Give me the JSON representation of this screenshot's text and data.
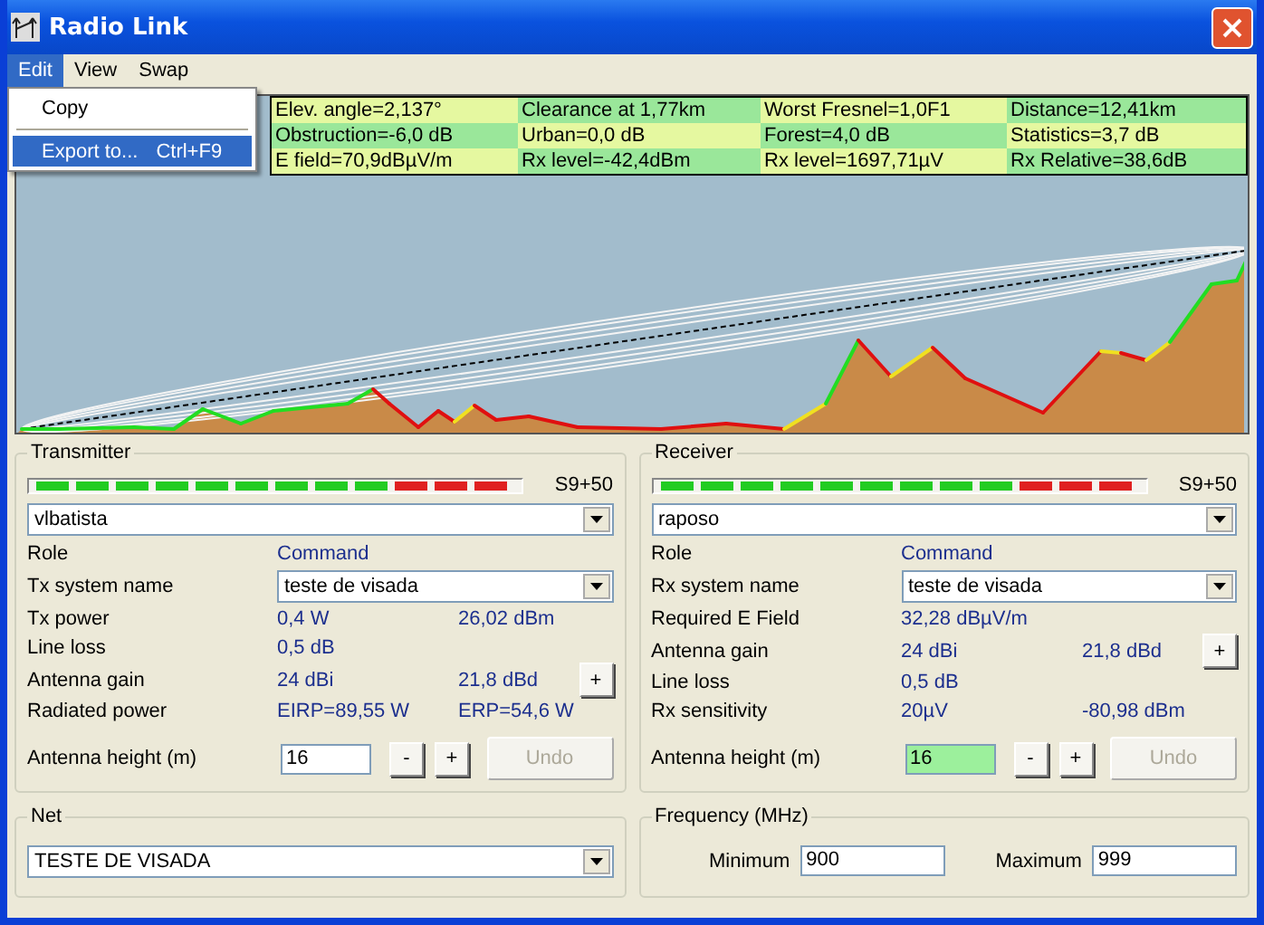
{
  "window": {
    "title": "Radio Link"
  },
  "menu": [
    {
      "label": "Edit",
      "selected": true
    },
    {
      "label": "View",
      "selected": false
    },
    {
      "label": "Swap",
      "selected": false
    }
  ],
  "edit_menu": [
    {
      "label": "Copy",
      "selected": false
    },
    {
      "label": "Export to...",
      "shortcut": "Ctrl+F9",
      "selected": true
    }
  ],
  "results": [
    [
      "Elev. angle=2,137°",
      "Clearance at 1,77km",
      "Worst Fresnel=1,0F1",
      "Distance=12,41km"
    ],
    [
      "Obstruction=-6,0 dB",
      "Urban=0,0 dB",
      "Forest=4,0 dB",
      "Statistics=3,7 dB"
    ],
    [
      "E field=70,9dBµV/m",
      "Rx level=-42,4dBm",
      "Rx level=1697,71µV",
      "Rx Relative=38,6dB"
    ]
  ],
  "transmitter": {
    "title": "Transmitter",
    "meter": {
      "level": 1,
      "reading": "S9+50"
    },
    "station": "vlbatista",
    "rows": [
      {
        "kind": "text",
        "label": "Role",
        "value": "Command"
      },
      {
        "kind": "select",
        "label": "Tx system name",
        "value": "teste de visada"
      },
      {
        "kind": "pair",
        "label": "Tx power",
        "value": "0,4 W",
        "value2": "26,02 dBm"
      },
      {
        "kind": "text",
        "label": "Line loss",
        "value": "0,5 dB"
      },
      {
        "kind": "gain",
        "label": "Antenna gain",
        "value": "24 dBi",
        "value2": "21,8 dBd",
        "button": "+"
      },
      {
        "kind": "pair",
        "label": "Radiated power",
        "value": "EIRP=89,55 W",
        "value2": "ERP=54,6 W"
      }
    ],
    "height": {
      "label": "Antenna height (m)",
      "value": "16",
      "highlighted": false,
      "minus": "-",
      "plus": "+",
      "undo": "Undo",
      "undo_disabled": true
    }
  },
  "receiver": {
    "title": "Receiver",
    "meter": {
      "level": 1,
      "reading": "S9+50"
    },
    "station": "raposo",
    "rows": [
      {
        "kind": "text",
        "label": "Role",
        "value": "Command"
      },
      {
        "kind": "select",
        "label": "Rx system name",
        "value": "teste de visada"
      },
      {
        "kind": "text",
        "label": "Required E Field",
        "value": "32,28 dBµV/m"
      },
      {
        "kind": "gain",
        "label": "Antenna gain",
        "value": "24 dBi",
        "value2": "21,8 dBd",
        "button": "+"
      },
      {
        "kind": "text",
        "label": "Line loss",
        "value": "0,5 dB"
      },
      {
        "kind": "pair",
        "label": "Rx sensitivity",
        "value": "20µV",
        "value2": "-80,98 dBm"
      }
    ],
    "height": {
      "label": "Antenna height (m)",
      "value": "16",
      "highlighted": true,
      "minus": "-",
      "plus": "+",
      "undo": "Undo",
      "undo_disabled": true
    }
  },
  "net": {
    "title": "Net",
    "value": "TESTE DE VISADA"
  },
  "frequency": {
    "title": "Frequency (MHz)",
    "min_label": "Minimum",
    "min": "900",
    "max_label": "Maximum",
    "max": "999"
  }
}
